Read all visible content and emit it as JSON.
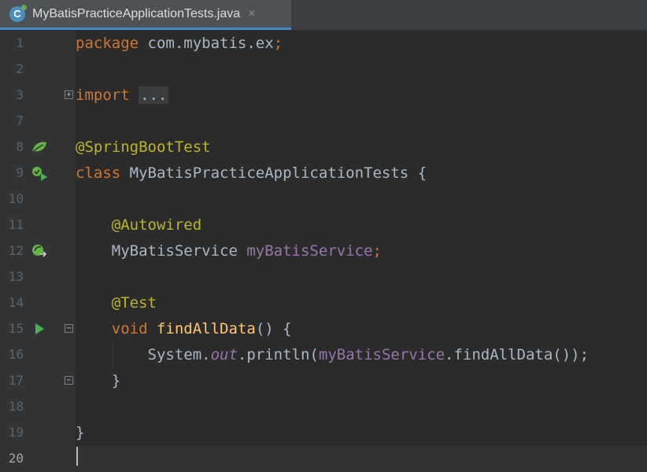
{
  "tab": {
    "icon_letter": "C",
    "title": "MyBatisPracticeApplicationTests.java",
    "close": "×"
  },
  "colors": {
    "keyword": "#cc7832",
    "annotation": "#bbb529",
    "field": "#9876aa",
    "method": "#ffc66d",
    "text": "#a9b7c6"
  },
  "lines": [
    {
      "num": "1",
      "t1": "package",
      "t2": " com.mybatis.ex",
      "t3": ";"
    },
    {
      "num": "2"
    },
    {
      "num": "3",
      "t1": "import",
      "t2": " ",
      "t3": "..."
    },
    {
      "num": "7"
    },
    {
      "num": "8",
      "t1": "@SpringBootTest"
    },
    {
      "num": "9",
      "t1": "class",
      "t2": " MyBatisPracticeApplicationTests {"
    },
    {
      "num": "10"
    },
    {
      "num": "11",
      "t1": "    ",
      "t2": "@Autowired"
    },
    {
      "num": "12",
      "t1": "    MyBatisService ",
      "t2": "myBatisService",
      "t3": ";"
    },
    {
      "num": "13"
    },
    {
      "num": "14",
      "t1": "    ",
      "t2": "@Test"
    },
    {
      "num": "15",
      "t1": "    ",
      "t2": "void",
      "t3": " ",
      "t4": "findAllData",
      "t5": "() {"
    },
    {
      "num": "16",
      "t1": "        System.",
      "t2": "out",
      "t3": ".println(",
      "t4": "myBatisService",
      "t5": ".findAllData());"
    },
    {
      "num": "17",
      "t1": "    }"
    },
    {
      "num": "18"
    },
    {
      "num": "19",
      "t1": "}"
    },
    {
      "num": "20"
    }
  ]
}
